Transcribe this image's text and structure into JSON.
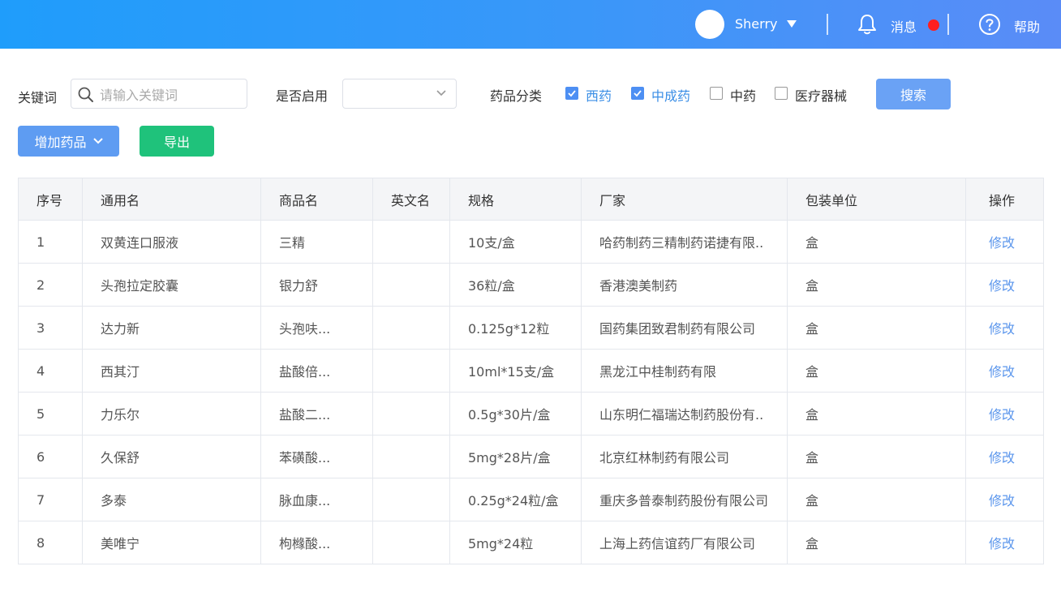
{
  "header": {
    "username": "Sherry",
    "messages_label": "消息",
    "help_label": "帮助",
    "notification_color": "#ff1f1f",
    "icons": [
      "avatar",
      "caret-down-icon",
      "bell-icon",
      "help-circle-icon"
    ]
  },
  "filters": {
    "keyword_label": "关键词",
    "keyword_placeholder": "请输入关键词",
    "enabled_label": "是否启用",
    "enabled_value": "",
    "category_label": "药品分类",
    "categories": [
      {
        "label": "西药",
        "checked": true
      },
      {
        "label": "中成药",
        "checked": true
      },
      {
        "label": "中药",
        "checked": false
      },
      {
        "label": "医疗器械",
        "checked": false
      }
    ],
    "search_button": "搜索"
  },
  "actions": {
    "add_button": "增加药品",
    "export_button": "导出"
  },
  "table": {
    "columns": [
      "序号",
      "通用名",
      "商品名",
      "英文名",
      "规格",
      "厂家",
      "包装单位",
      "操作"
    ],
    "rows": [
      {
        "id": "1",
        "generic": "双黄连口服液",
        "brand": "三精",
        "english": "",
        "spec": "10支/盒",
        "maker": "哈药制药三精制药诺捷有限..",
        "unit": "盒",
        "op": "修改"
      },
      {
        "id": "2",
        "generic": "头孢拉定胶囊",
        "brand": "银力舒",
        "english": "",
        "spec": "36粒/盒",
        "maker": "香港澳美制药",
        "unit": "盒",
        "op": "修改"
      },
      {
        "id": "3",
        "generic": "达力新",
        "brand": "头孢呋...",
        "english": "",
        "spec": "0.125g*12粒",
        "maker": "国药集团致君制药有限公司",
        "unit": "盒",
        "op": "修改"
      },
      {
        "id": "4",
        "generic": "西其汀",
        "brand": "盐酸倍...",
        "english": "",
        "spec": "10ml*15支/盒",
        "maker": "黑龙江中桂制药有限",
        "unit": "盒",
        "op": "修改"
      },
      {
        "id": "5",
        "generic": "力乐尔",
        "brand": "盐酸二...",
        "english": "",
        "spec": "0.5g*30片/盒",
        "maker": "山东明仁福瑞达制药股份有..",
        "unit": "盒",
        "op": "修改"
      },
      {
        "id": "6",
        "generic": "久保舒",
        "brand": "苯磺酸...",
        "english": "",
        "spec": "5mg*28片/盒",
        "maker": "北京红林制药有限公司",
        "unit": "盒",
        "op": "修改"
      },
      {
        "id": "7",
        "generic": "多泰",
        "brand": "脉血康...",
        "english": "",
        "spec": "0.25g*24粒/盒",
        "maker": "重庆多普泰制药股份有限公司",
        "unit": "盒",
        "op": "修改"
      },
      {
        "id": "8",
        "generic": "美唯宁",
        "brand": "枸橼酸...",
        "english": "",
        "spec": "5mg*24粒",
        "maker": "上海上药信谊药厂有限公司",
        "unit": "盒",
        "op": "修改"
      }
    ]
  },
  "colors": {
    "header_gradient": [
      "#1f9dfb",
      "#5a8cf7"
    ],
    "primary": "#5e9cf2",
    "success": "#1fc27b",
    "link": "#5b96ec"
  }
}
